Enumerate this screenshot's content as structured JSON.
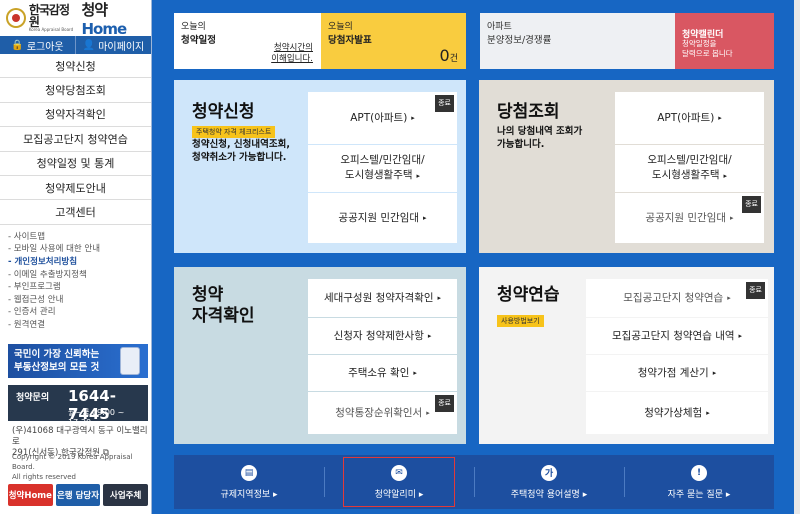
{
  "logo": {
    "org_name": "한국감정원",
    "org_en": "Korea Appraisal Board",
    "brand_prefix": "청약",
    "brand_home": "Home"
  },
  "auth": {
    "logout": "로그아웃",
    "mypage": "마이페이지"
  },
  "nav": [
    "청약신청",
    "청약당첨조회",
    "청약자격확인",
    "모집공고단지 청약연습",
    "청약일정 및 통계",
    "청약제도안내",
    "고객센터"
  ],
  "sublinks": [
    "- 사이트맵",
    "- 모바일 사용에 대한 안내",
    "- 개인정보처리방침",
    "- 이메일 추출방지정책",
    "- 부인프로그램",
    "- 웹접근성 안내",
    "- 인증서 관리",
    "- 원격연결"
  ],
  "banner": {
    "line1": "국민이 가장 신뢰하는",
    "line2": "부동산정보의 모든 것"
  },
  "callcenter": {
    "label": "청약문의",
    "number": "1644-7445",
    "hours": "월~금 09:00 ~ 17:30"
  },
  "address": {
    "line1": "(우)41068 대구광역시 동구 이노밸리로",
    "line2": "291(신서동) 한국감정원"
  },
  "copyright": {
    "line1": "Copyright © 2019 Korea Appraisal Board.",
    "line2": "All rights reserved"
  },
  "footer_buttons": [
    "청약Home",
    "은행 담당자",
    "사업주체"
  ],
  "top_cards": {
    "schedule": {
      "small": "오늘의",
      "big": "청약일정",
      "link_line1": "청약시간의",
      "link_line2": "이해입니다."
    },
    "winners": {
      "small": "오늘의",
      "big": "당첨자발표",
      "count": "0",
      "unit": "건"
    },
    "apt": {
      "small": "아파트",
      "big": "분양정보/경쟁률"
    },
    "calendar": {
      "big": "청약캘린더",
      "desc_line1": "청약일정을",
      "desc_line2": "달력으로 봅니다"
    }
  },
  "panels": {
    "apply": {
      "title": "청약신청",
      "badge": "주택청약 자격 체크리스트",
      "desc_line1": "청약신청, 신청내역조회,",
      "desc_line2": "청약취소가 가능합니다.",
      "items": [
        {
          "label": "APT(아파트)",
          "tag": "종료"
        },
        {
          "line1": "오피스텔/민간임대/",
          "line2": "도시형생활주택"
        },
        {
          "label": "공공지원 민간임대"
        }
      ]
    },
    "winners": {
      "title": "당첨조회",
      "desc_line1": "나의 당첨내역 조회가",
      "desc_line2": "가능합니다.",
      "items": [
        {
          "label": "APT(아파트)"
        },
        {
          "line1": "오피스텔/민간임대/",
          "line2": "도시형생활주택"
        },
        {
          "label": "공공지원 민간임대",
          "tag": "종료"
        }
      ]
    },
    "eligibility": {
      "title_line1": "청약",
      "title_line2": "자격확인",
      "items": [
        {
          "label": "세대구성원 청약자격확인"
        },
        {
          "label": "신청자 청약제한사항"
        },
        {
          "label": "주택소유 확인"
        },
        {
          "label": "청약통장순위확인서",
          "tag": "종료"
        }
      ]
    },
    "practice": {
      "title": "청약연습",
      "badge": "사용방법보기",
      "items": [
        {
          "label": "모집공고단지 청약연습",
          "tag": "종료"
        },
        {
          "label": "모집공고단지 청약연습 내역"
        },
        {
          "label": "청약가점 계산기"
        },
        {
          "label": "청약가상체험"
        }
      ]
    }
  },
  "bottom_bar": [
    {
      "label": "규제지역정보",
      "icon": "building-icon",
      "glyph": "▤"
    },
    {
      "label": "청약알리미",
      "icon": "mail-icon",
      "glyph": "✉"
    },
    {
      "label": "주택청약 용어설명",
      "icon": "ga-icon",
      "glyph": "가"
    },
    {
      "label": "자주 묻는 질문",
      "icon": "exclaim-icon",
      "glyph": "!"
    }
  ],
  "arrow": "▸"
}
